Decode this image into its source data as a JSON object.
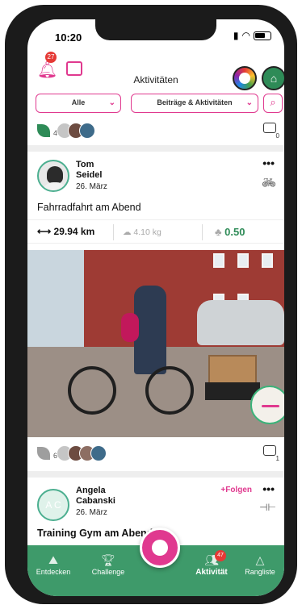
{
  "status": {
    "time": "10:20"
  },
  "header": {
    "title": "Aktivitäten",
    "notification_count": "27"
  },
  "filters": {
    "scope": "Alle",
    "type": "Beiträge & Aktivitäten"
  },
  "feed_summary": {
    "leaf_count": "4",
    "comment_count": "0"
  },
  "posts": [
    {
      "author_first": "Tom",
      "author_last": "Seidel",
      "date": "26. März",
      "title": "Fahrradfahrt am Abend",
      "distance": "29.94 km",
      "co2": "4.10 kg",
      "points": "0.50",
      "activity_icon": "bicycle-icon",
      "leaf_count": "6",
      "comment_count": "1"
    },
    {
      "initials": "A C",
      "author_first": "Angela",
      "author_last": "Cabanski",
      "date": "26. März",
      "title": "Training Gym am Abend",
      "follow_label": "+Folgen",
      "activity_icon": "dumbbell-icon"
    }
  ],
  "nav": {
    "items": [
      {
        "label": "Entdecken",
        "icon": "discover-icon"
      },
      {
        "label": "Challenge",
        "icon": "trophy-icon"
      },
      {
        "label": "Aktivität",
        "icon": "people-icon",
        "badge": "47"
      },
      {
        "label": "Rangliste",
        "icon": "triangle-icon"
      }
    ]
  },
  "colors": {
    "accent": "#e0398f",
    "brand_green": "#3e9a6a",
    "points_green": "#2e8b57"
  }
}
